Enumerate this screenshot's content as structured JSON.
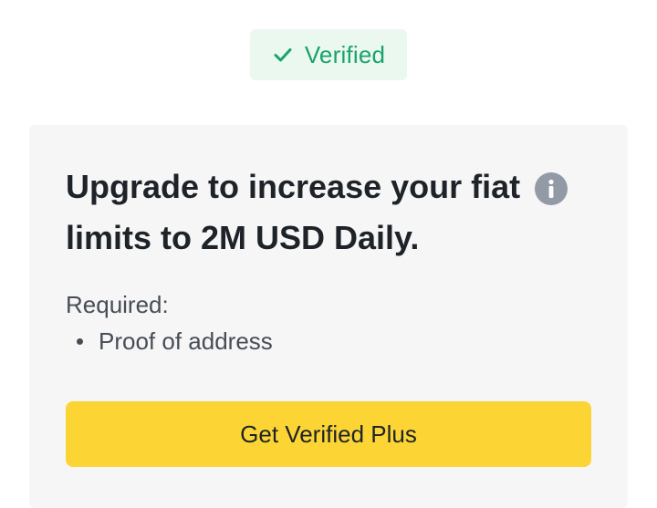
{
  "status_badge": {
    "label": "Verified",
    "icon": "checkmark-icon",
    "color": "#1aa36a",
    "background": "#eaf8f0"
  },
  "upgrade_card": {
    "title": "Upgrade to increase your fiat limits to 2M USD Daily.",
    "info_icon": "info-icon",
    "required_label": "Required:",
    "requirements": [
      {
        "label": "Proof of address"
      }
    ],
    "cta_label": "Get Verified Plus",
    "cta_color": "#fcd535",
    "background": "#f6f6f6"
  }
}
